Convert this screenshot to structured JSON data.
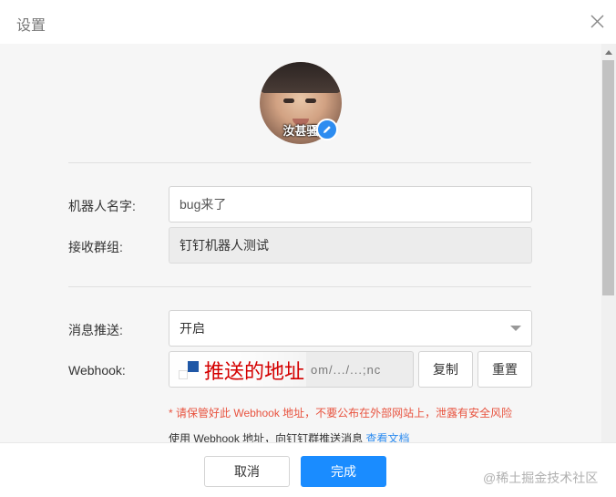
{
  "dialog": {
    "title": "设置"
  },
  "avatar": {
    "caption": "汝甚骚"
  },
  "form": {
    "robot_name": {
      "label": "机器人名字:",
      "value": "bug来了"
    },
    "group": {
      "label": "接收群组:",
      "value": "钉钉机器人测试"
    },
    "push": {
      "label": "消息推送:",
      "value": "开启"
    },
    "webhook": {
      "label": "Webhook:",
      "value_fragment": "om/.../...;nc",
      "overlay_text": "推送的地址",
      "copy_label": "复制",
      "reset_label": "重置"
    },
    "warning": "* 请保管好此 Webhook 地址，不要公布在外部网站上，泄露有安全风险",
    "hint_text": "使用 Webhook 地址，向钉钉群推送消息",
    "hint_link": "查看文档"
  },
  "footer": {
    "cancel_label": "取消",
    "ok_label": "完成",
    "watermark": "@稀土掘金技术社区"
  },
  "colors": {
    "primary": "#1a8cff",
    "warning": "#e8533f",
    "link": "#2d8cf0"
  },
  "icons": [
    "close-icon",
    "pencil-icon",
    "caret-down-icon"
  ]
}
